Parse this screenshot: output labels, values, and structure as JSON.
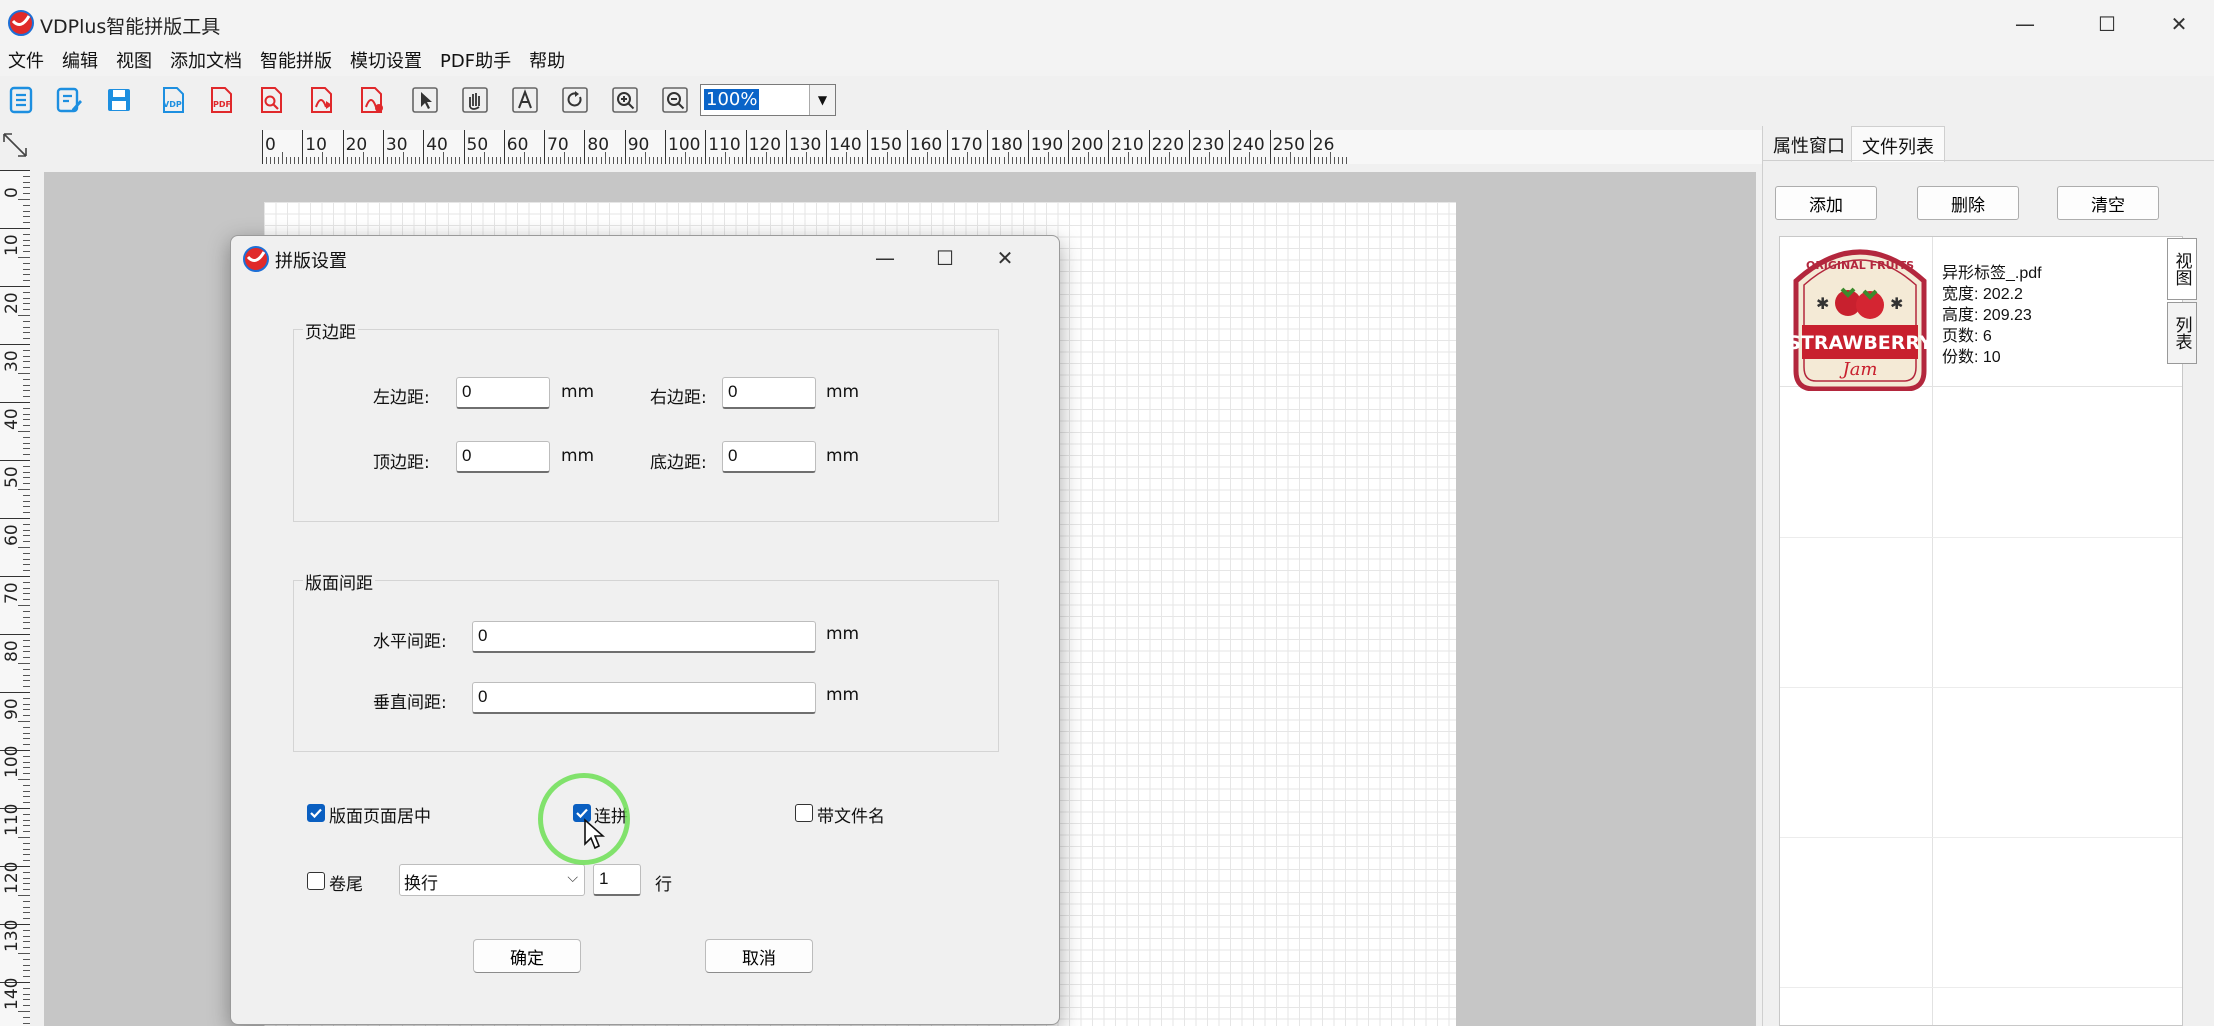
{
  "app": {
    "title": "VDPlus智能拼版工具"
  },
  "window_controls": {
    "minimize": "—",
    "maximize": "☐",
    "close": "✕"
  },
  "menu": [
    "文件",
    "编辑",
    "视图",
    "添加文档",
    "智能拼版",
    "模切设置",
    "PDF助手",
    "帮助"
  ],
  "toolbar": {
    "icons": [
      "new-list-icon",
      "edit-icon",
      "save-icon",
      "vdp-icon",
      "pdf-icon",
      "pdf-search-icon",
      "pdf-export-icon",
      "pdf-convert-icon",
      "pointer-icon",
      "hand-icon",
      "text-icon",
      "rotate-icon",
      "zoom-in-icon",
      "zoom-out-icon"
    ],
    "zoom": "100%"
  },
  "ruler": {
    "h": [
      "0",
      "10",
      "20",
      "30",
      "40",
      "50",
      "60",
      "70",
      "80",
      "90",
      "100",
      "110",
      "120",
      "130",
      "140",
      "150",
      "160",
      "170",
      "180",
      "190",
      "200",
      "210",
      "220",
      "230",
      "240",
      "250",
      "26"
    ],
    "v": [
      "0",
      "10",
      "20",
      "30",
      "40",
      "50",
      "60",
      "70",
      "80",
      "90",
      "100",
      "110",
      "120",
      "130",
      "140"
    ]
  },
  "right_panel": {
    "tabs": [
      "属性窗口",
      "文件列表"
    ],
    "buttons": {
      "add": "添加",
      "delete": "删除",
      "clear": "清空"
    },
    "side_tabs": [
      "视图",
      "列表"
    ],
    "file": {
      "name": "异形标签_.pdf",
      "width": "宽度: 202.2",
      "height": "高度: 209.23",
      "pages": "页数: 6",
      "copies": "份数: 10",
      "thumb": {
        "top": "ORIGINAL FRUITS",
        "main": "STRAWBERRY",
        "sub": "Jam"
      }
    }
  },
  "dialog": {
    "title": "拼版设置",
    "margin_group": {
      "legend": "页边距",
      "left_label": "左边距:",
      "left_value": "0",
      "right_label": "右边距:",
      "right_value": "0",
      "top_label": "顶边距:",
      "top_value": "0",
      "bottom_label": "底边距:",
      "bottom_value": "0",
      "unit": "mm"
    },
    "spacing_group": {
      "legend": "版面间距",
      "h_label": "水平间距:",
      "h_value": "0",
      "v_label": "垂直间距:",
      "v_value": "0",
      "unit": "mm"
    },
    "options": {
      "center": {
        "label": "版面页面居中",
        "checked": true
      },
      "continuous": {
        "label": "连拼",
        "checked": true
      },
      "filename": {
        "label": "带文件名",
        "checked": false
      },
      "tail": {
        "label": "卷尾",
        "checked": false
      },
      "tail_mode": "换行",
      "tail_count": "1",
      "tail_unit": "行"
    },
    "buttons": {
      "ok": "确定",
      "cancel": "取消"
    }
  },
  "colors": {
    "accent": "#0a5fc1",
    "pdf_red": "#e0282b",
    "blue_icon": "#1d8fe0",
    "click_ring": "#6ddf55"
  }
}
